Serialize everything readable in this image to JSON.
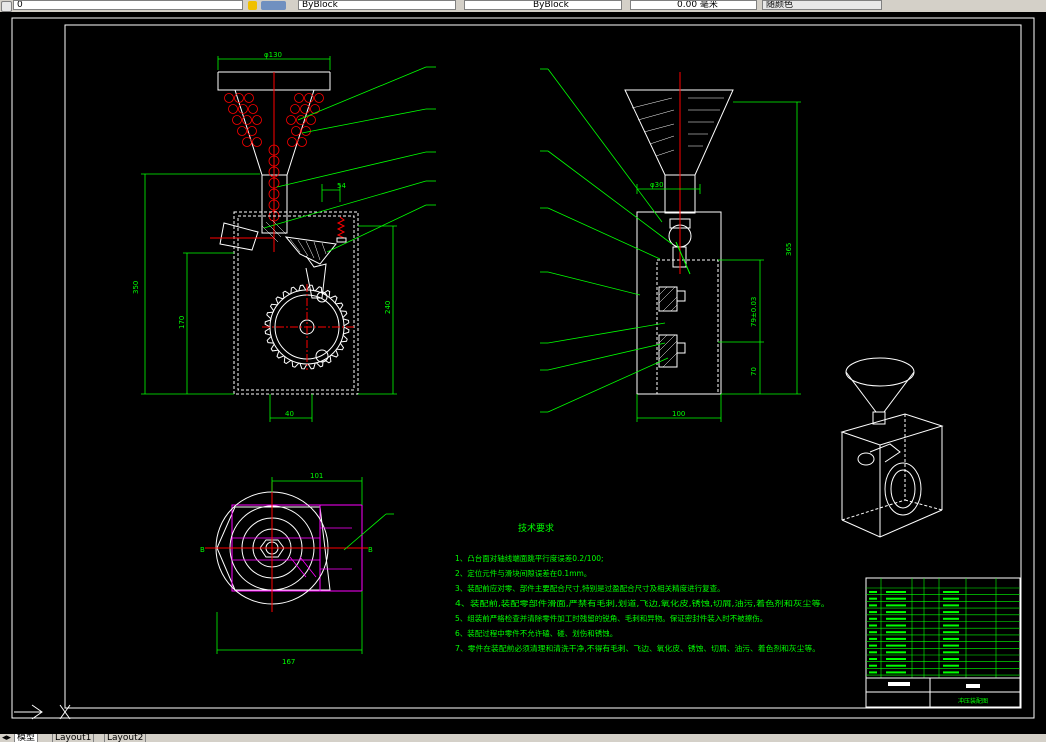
{
  "toolbar": {
    "layer_value": "0",
    "linetype_value": "ByBlock",
    "lineweight_value": "ByBlock",
    "lineweight_unit": "0.00 毫米",
    "plotstyle_value": "随颜色"
  },
  "layout_tabs": [
    "模型",
    "Layout1",
    "Layout2"
  ],
  "drawing": {
    "front_view": {
      "dim_top_width": "φ130",
      "dim_total_height": "350",
      "dim_box_height": "170",
      "dim_right_height": "240",
      "dim_bottom": "40",
      "dim_mid": "54"
    },
    "side_view": {
      "dim_small": "φ30",
      "dim_total": "365",
      "dim_fit": "79±0.03",
      "dim_lower": "70",
      "dim_bottom": "100"
    },
    "top_view": {
      "dim_top": "101",
      "dim_bottom": "167",
      "label_left": "B",
      "label_right": "B"
    },
    "tech_requirements": {
      "title": "技术要求",
      "lines": [
        "1、凸台面对轴线端面跳平行度误差0.2/100;",
        "2、定位元件与滑块间隙误差在0.1mm。",
        "3、装配前应对零、部件主要配合尺寸,特别是过盈配合尺寸及相关精度进行复查。",
        "4、装配前,装配零部件滑面,严禁有毛刺,划道,飞边,氧化皮,锈蚀,切屑,油污,着色剂和灰尘等。",
        "5、组装前严格检查并清除零件加工时残留的锐角、毛刺和异物。保证密封件装入时不被擦伤。",
        "6、装配过程中零件不允许磕、碰、划伤和锈蚀。",
        "7、零件在装配前必须清理和清洗干净,不得有毛刺、飞边、氧化皮、锈蚀、切屑、油污、着色剂和灰尘等。"
      ]
    },
    "title_block": {
      "drawing_name": "冲压装配图"
    }
  },
  "colors": {
    "background": "#000000",
    "line_white": "#ffffff",
    "line_green": "#00ff00",
    "line_red": "#ff0000",
    "line_magenta": "#ff00ff",
    "line_yellow": "#ffff00"
  }
}
